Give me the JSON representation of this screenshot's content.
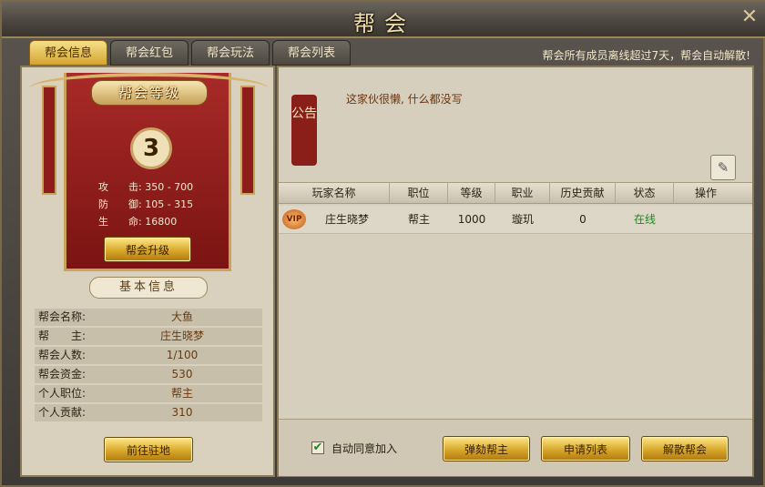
{
  "window": {
    "title": "帮会",
    "close_icon": "close-icon"
  },
  "tabs": [
    {
      "label": "帮会信息",
      "active": true
    },
    {
      "label": "帮会红包",
      "active": false
    },
    {
      "label": "帮会玩法",
      "active": false
    },
    {
      "label": "帮会列表",
      "active": false
    }
  ],
  "notice_banner": "帮会所有成员离线超过7天，帮会自动解散!",
  "level_card": {
    "title": "帮会等级",
    "level": "3",
    "stats": [
      {
        "label": "攻　　击:",
        "value": "350 - 700"
      },
      {
        "label": "防　　御:",
        "value": "105 - 315"
      },
      {
        "label": "生　　命:",
        "value": "16800"
      }
    ],
    "upgrade_button": "帮会升级"
  },
  "basic_info": {
    "heading": "基本信息",
    "rows": [
      {
        "label": "帮会名称:",
        "value": "大鱼"
      },
      {
        "label": "帮　　主:",
        "value": "庄生晓梦"
      },
      {
        "label": "帮会人数:",
        "value": "1/100"
      },
      {
        "label": "帮会资金:",
        "value": "530"
      },
      {
        "label": "个人职位:",
        "value": "帮主"
      },
      {
        "label": "个人贡献:",
        "value": "310"
      }
    ],
    "goto_button": "前往驻地"
  },
  "announcement": {
    "badge": "公告",
    "text": "这家伙很懒, 什么都没写",
    "edit_icon": "pencil-icon"
  },
  "member_table": {
    "headers": [
      "玩家名称",
      "职位",
      "等级",
      "职业",
      "历史贡献",
      "状态",
      "操作"
    ],
    "rows": [
      {
        "vip": "VIP",
        "name": "庄生晓梦",
        "position": "帮主",
        "level": "1000",
        "class": "璇玑",
        "contribution": "0",
        "status": "在线",
        "action": ""
      }
    ]
  },
  "footer": {
    "auto_accept_label": "自动同意加入",
    "auto_accept_checked": true,
    "buttons": [
      "弹劾帮主",
      "申请列表",
      "解散帮会"
    ]
  },
  "colors": {
    "accent_gold": "#d7a82a",
    "online_green": "#1a8a1a",
    "banner_red": "#a82a28"
  }
}
